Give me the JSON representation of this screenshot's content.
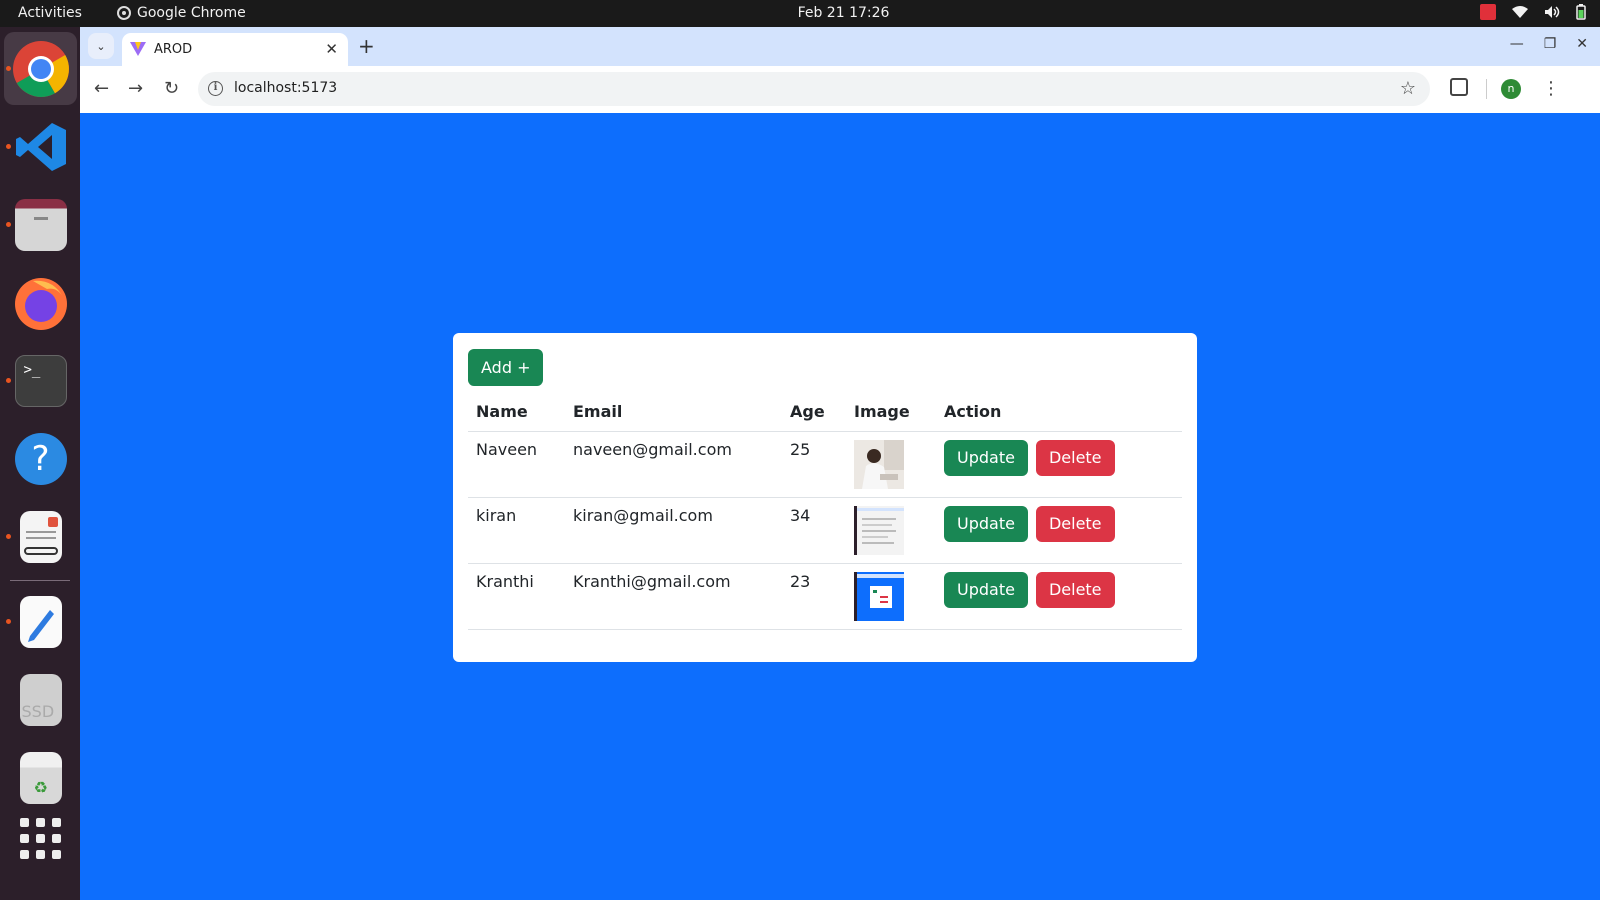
{
  "topbar": {
    "activities": "Activities",
    "app_name": "Google Chrome",
    "datetime": "Feb 21  17:26"
  },
  "dock": {
    "items": [
      "chrome-icon",
      "vscode-icon",
      "files-icon",
      "firefox-icon",
      "terminal-icon",
      "help-icon",
      "document-viewer-icon",
      "text-editor-icon",
      "ssd-drive-icon",
      "trash-icon",
      "show-apps-icon"
    ],
    "ssd_label": "SSD"
  },
  "browser": {
    "tab_title": "AROD",
    "url": "localhost:5173",
    "profile_initial": "n"
  },
  "page": {
    "add_button": "Add +",
    "columns": [
      "Name",
      "Email",
      "Age",
      "Image",
      "Action"
    ],
    "rows": [
      {
        "name": "Naveen",
        "email": "naveen@gmail.com",
        "age": "25",
        "image": "person-photo"
      },
      {
        "name": "kiran",
        "email": "kiran@gmail.com",
        "age": "34",
        "image": "screenshot-white"
      },
      {
        "name": "Kranthi",
        "email": "Kranthi@gmail.com",
        "age": "23",
        "image": "screenshot-blue"
      }
    ],
    "update_label": "Update",
    "delete_label": "Delete"
  },
  "colors": {
    "page_background": "#0d6efd",
    "success": "#198754",
    "danger": "#dc3545"
  }
}
